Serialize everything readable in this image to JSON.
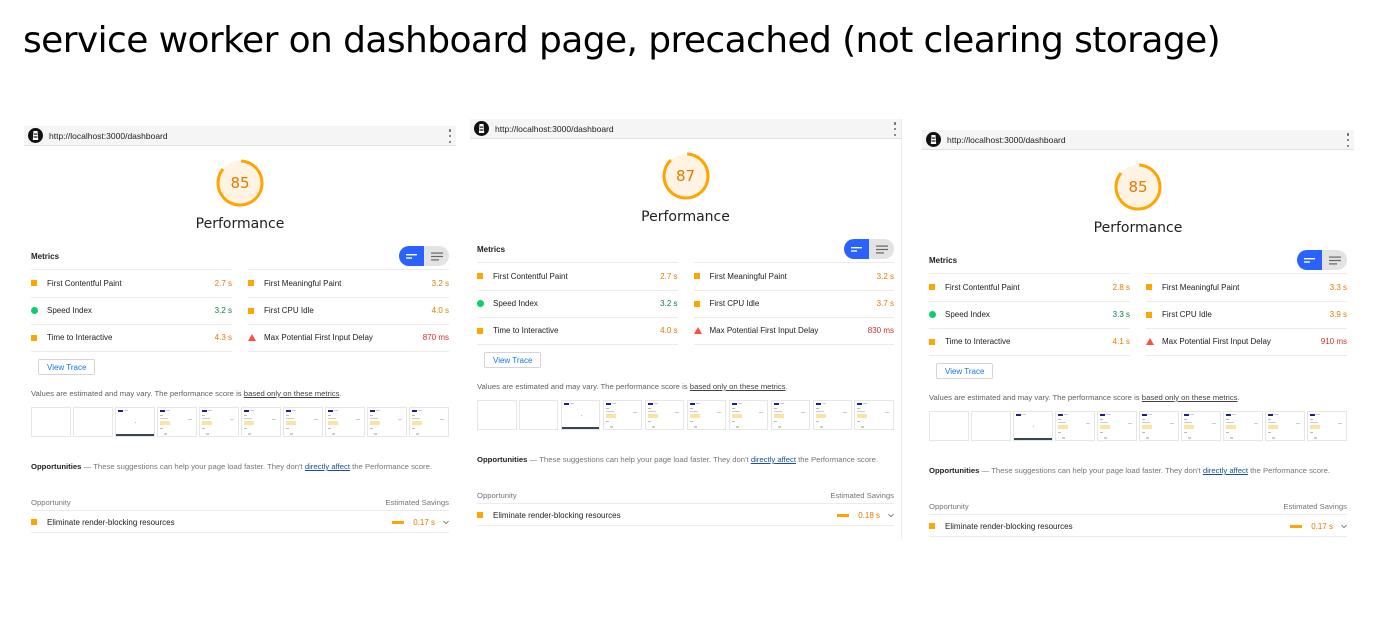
{
  "slide_title": "service worker on dashboard page, precached (not clearing storage)",
  "colors": {
    "average": "#ffa400",
    "average_text": "#e67700",
    "pass": "#0cce6b",
    "pass_text": "#0b8043",
    "fail": "#ff4e42",
    "fail_text": "#d32f2f",
    "toggle_active": "#2962ff",
    "link": "#1a73e8"
  },
  "shared": {
    "category_label": "Performance",
    "metrics_title": "Metrics",
    "view_trace_label": "View Trace",
    "values_note_prefix": "Values are estimated and may vary. The performance score is ",
    "values_note_link": "based only on these metrics",
    "values_note_suffix": ".",
    "opportunities_title": "Opportunities",
    "opportunities_desc_prefix": " — These suggestions can help your page load faster. They don't ",
    "opportunities_link": "directly affect",
    "opportunities_desc_suffix": " the Performance score.",
    "opp_col_left": "Opportunity",
    "opp_col_right": "Estimated Savings",
    "icons": {
      "logo": "lighthouse-logo-icon",
      "menu": "kebab-menu-icon",
      "toggle_a": "compact-view-icon",
      "toggle_b": "expanded-view-icon",
      "expand": "chevron-down-icon"
    }
  },
  "reports": [
    {
      "url": "http://localhost:3000/dashboard",
      "score": "85",
      "score_fraction": 0.85,
      "metrics": [
        {
          "name": "First Contentful Paint",
          "value": "2.7 s",
          "status": "average"
        },
        {
          "name": "First Meaningful Paint",
          "value": "3.2 s",
          "status": "average"
        },
        {
          "name": "Speed Index",
          "value": "3.2 s",
          "status": "pass"
        },
        {
          "name": "First CPU Idle",
          "value": "4.0 s",
          "status": "average"
        },
        {
          "name": "Time to Interactive",
          "value": "4.3 s",
          "status": "average"
        },
        {
          "name": "Max Potential First Input Delay",
          "value": "870 ms",
          "status": "fail"
        }
      ],
      "opportunity": {
        "name": "Eliminate render-blocking resources",
        "savings": "0.17 s",
        "status": "average"
      }
    },
    {
      "url": "http://localhost:3000/dashboard",
      "score": "87",
      "score_fraction": 0.87,
      "metrics": [
        {
          "name": "First Contentful Paint",
          "value": "2.7 s",
          "status": "average"
        },
        {
          "name": "First Meaningful Paint",
          "value": "3.2 s",
          "status": "average"
        },
        {
          "name": "Speed Index",
          "value": "3.2 s",
          "status": "pass"
        },
        {
          "name": "First CPU Idle",
          "value": "3.7 s",
          "status": "average"
        },
        {
          "name": "Time to Interactive",
          "value": "4.0 s",
          "status": "average"
        },
        {
          "name": "Max Potential First Input Delay",
          "value": "830 ms",
          "status": "fail"
        }
      ],
      "opportunity": {
        "name": "Eliminate render-blocking resources",
        "savings": "0.18 s",
        "status": "average"
      }
    },
    {
      "url": "http://localhost:3000/dashboard",
      "score": "85",
      "score_fraction": 0.85,
      "metrics": [
        {
          "name": "First Contentful Paint",
          "value": "2.8 s",
          "status": "average"
        },
        {
          "name": "First Meaningful Paint",
          "value": "3.3 s",
          "status": "average"
        },
        {
          "name": "Speed Index",
          "value": "3.3 s",
          "status": "pass"
        },
        {
          "name": "First CPU Idle",
          "value": "3.9 s",
          "status": "average"
        },
        {
          "name": "Time to Interactive",
          "value": "4.1 s",
          "status": "average"
        },
        {
          "name": "Max Potential First Input Delay",
          "value": "910 ms",
          "status": "fail"
        }
      ],
      "opportunity": {
        "name": "Eliminate render-blocking resources",
        "savings": "0.17 s",
        "status": "average"
      }
    }
  ]
}
